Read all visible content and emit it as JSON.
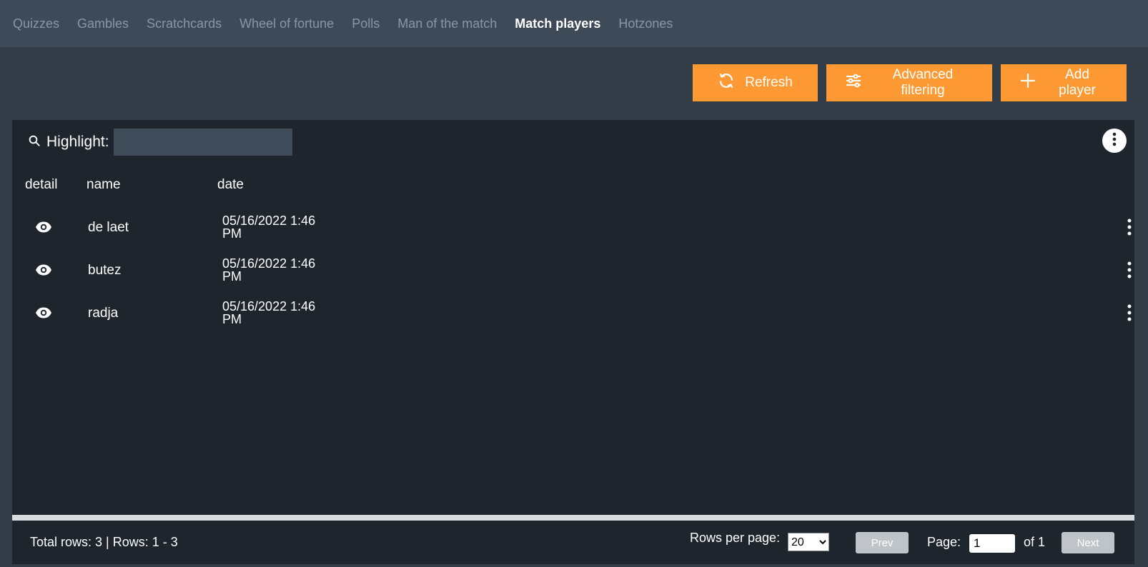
{
  "nav": {
    "tabs": [
      {
        "label": "Quizzes"
      },
      {
        "label": "Gambles"
      },
      {
        "label": "Scratchcards"
      },
      {
        "label": "Wheel of fortune"
      },
      {
        "label": "Polls"
      },
      {
        "label": "Man of the match"
      },
      {
        "label": "Match players"
      },
      {
        "label": "Hotzones"
      }
    ],
    "active_tab": "Match players"
  },
  "toolbar": {
    "refresh_label": "Refresh",
    "refresh_icon": "refresh-icon",
    "advanced_filtering_label": "Advanced filtering",
    "advanced_filtering_icon": "sliders-icon",
    "add_player_label": "Add player",
    "add_player_icon": "plus-icon"
  },
  "highlight": {
    "label": "Highlight:",
    "value": "",
    "icon": "search-icon"
  },
  "table": {
    "columns": [
      "detail",
      "name",
      "date"
    ],
    "rows": [
      {
        "name": "de laet",
        "date": "05/16/2022 1:46 PM"
      },
      {
        "name": "butez",
        "date": "05/16/2022 1:46 PM"
      },
      {
        "name": "radja",
        "date": "05/16/2022 1:46 PM"
      }
    ]
  },
  "footer": {
    "total_text": "Total rows: 3 | Rows: 1 - 3",
    "rows_per_page_label": "Rows per page:",
    "rows_per_page_value": "20",
    "prev_label": "Prev",
    "page_label": "Page:",
    "page_value": "1",
    "of_label": "of 1",
    "next_label": "Next"
  },
  "colors": {
    "accent": "#ff9933",
    "panel": "#1f252d",
    "background": "#333d48",
    "nav": "#3e4a58"
  }
}
